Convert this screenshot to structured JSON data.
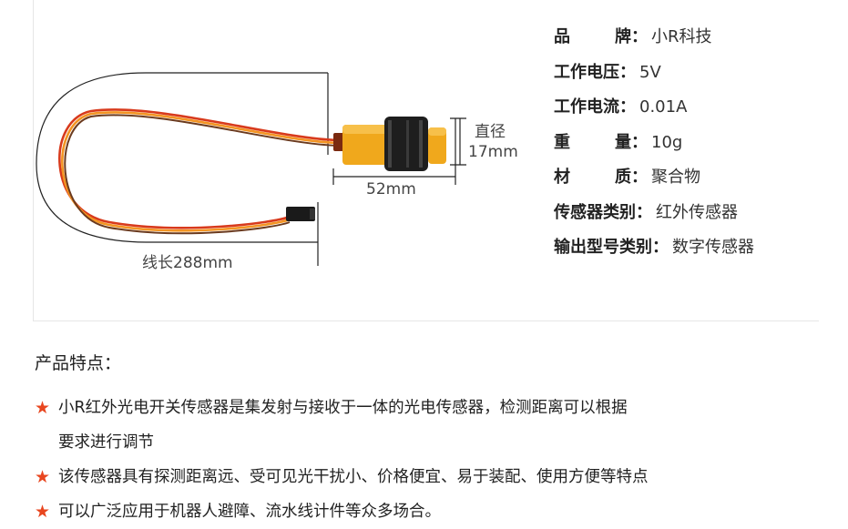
{
  "diagram": {
    "diameter_label": "直径",
    "diameter_value": "17mm",
    "length_label": "52mm",
    "wire_length_label": "线长288mm"
  },
  "specs": [
    {
      "label": "品牌",
      "value": "小R科技"
    },
    {
      "label": "工作电压",
      "value": "5V"
    },
    {
      "label": "工作电流",
      "value": "0.01A"
    },
    {
      "label": "重量",
      "value": "10g"
    },
    {
      "label": "材质",
      "value": "聚合物"
    },
    {
      "label": "传感器类别",
      "value": "红外传感器"
    },
    {
      "label": "输出型号类别",
      "value": "数字传感器"
    }
  ],
  "spec_colon": "：",
  "features": {
    "title": "产品特点：",
    "star_glyph": "★",
    "items": [
      {
        "line1": "小R红外光电开关传感器是集发射与接收于一体的光电传感器，检测距离可以根据",
        "line2": "要求进行调节"
      },
      {
        "line1": "该传感器具有探测距离远、受可见光干扰小、价格便宜、易于装配、使用方便等特点"
      },
      {
        "line1": "可以广泛应用于机器人避障、流水线计件等众多场合。"
      }
    ]
  },
  "colors": {
    "star": "#e8461f",
    "sensor_body": "#f0a81c",
    "wire_red": "#d83a1c",
    "wire_orange": "#f39422",
    "wire_brown": "#6b3a1e"
  }
}
